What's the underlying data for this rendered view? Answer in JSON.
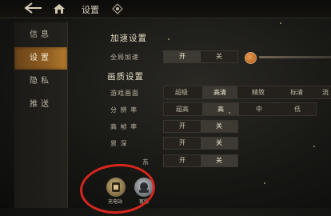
{
  "header": {
    "title": "设置"
  },
  "sidebar": {
    "items": [
      {
        "label": "信息"
      },
      {
        "label": "设置"
      },
      {
        "label": "隐私"
      },
      {
        "label": "推送"
      }
    ]
  },
  "accel": {
    "heading": "加速设置",
    "global_label": "全局加速",
    "on_label": "开",
    "off_label": "关"
  },
  "quality": {
    "heading": "画质设置",
    "scene_label": "游戏画面",
    "scene_options": [
      "超级",
      "高清",
      "精致",
      "标清",
      "流"
    ],
    "scene_selected": "高清",
    "res_label": "分 辨 率",
    "res_options": [
      "超高",
      "高",
      "中",
      "低"
    ],
    "res_selected": "高",
    "fps_label": "高 帧 率",
    "shadow_label": "景    深",
    "row5_label": "东"
  },
  "toggles": {
    "on": "开",
    "off": "关"
  },
  "bottom": {
    "btn1_label": "充电站",
    "btn2_label": "客服"
  },
  "colors": {
    "active_tab": "#8e5d22",
    "annotation": "#d8261f"
  }
}
